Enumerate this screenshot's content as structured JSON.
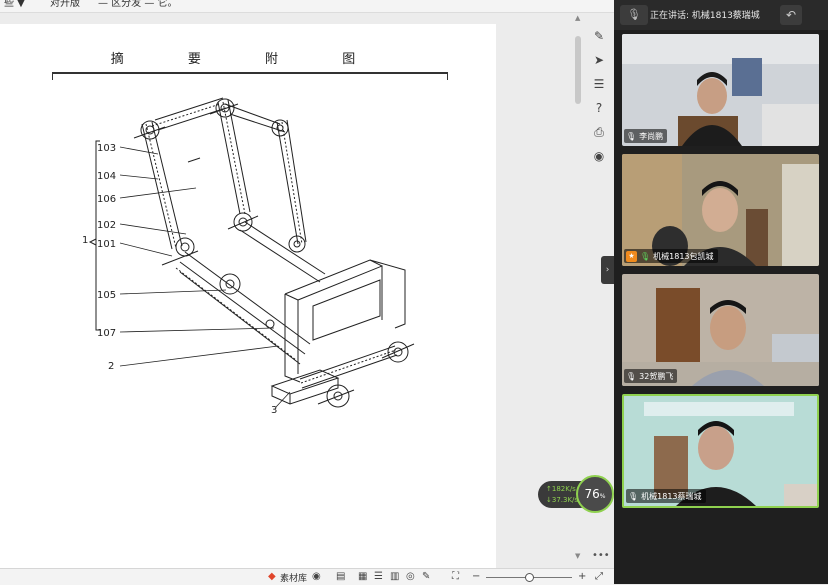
{
  "top_strip": {
    "fragment_1": "些 ▼",
    "fragment_2": "对开版",
    "fragment_3": "— 区分发 — 它。"
  },
  "document": {
    "title": "摘 要 附 图",
    "labels": {
      "l103": "103",
      "l104": "104",
      "l106": "106",
      "l102": "102",
      "l101": "101",
      "l1": "1",
      "l105": "105",
      "l107": "107",
      "l2": "2",
      "l3": "3"
    }
  },
  "right_toolbar": {
    "icons": [
      "pen-icon",
      "cursor-icon",
      "sliders-icon",
      "help-icon",
      "print-icon",
      "pin-icon"
    ]
  },
  "status_bar": {
    "material_library": "素材库",
    "zoom_plus": "+",
    "zoom_minus": "−"
  },
  "network": {
    "upload": "↑182",
    "upload_unit": "K/s",
    "download": "↓37.3",
    "download_unit": "K/s",
    "percent": "76",
    "percent_unit": "%"
  },
  "meeting": {
    "speaking_label": "正在讲话: 机械1813蔡瑞城",
    "participants": [
      {
        "name": "李尚鹏",
        "mic": "white",
        "host": false
      },
      {
        "name": "机械1813包凯城",
        "mic": "green",
        "host": true
      },
      {
        "name": "32贺鹏飞",
        "mic": "white",
        "host": false
      },
      {
        "name": "机械1813蔡瑞城",
        "mic": "white",
        "host": false
      }
    ]
  },
  "colors": {
    "accent_green": "#8fd14f",
    "host_orange": "#f08a1d",
    "panel_dark": "#1f1f1f"
  }
}
